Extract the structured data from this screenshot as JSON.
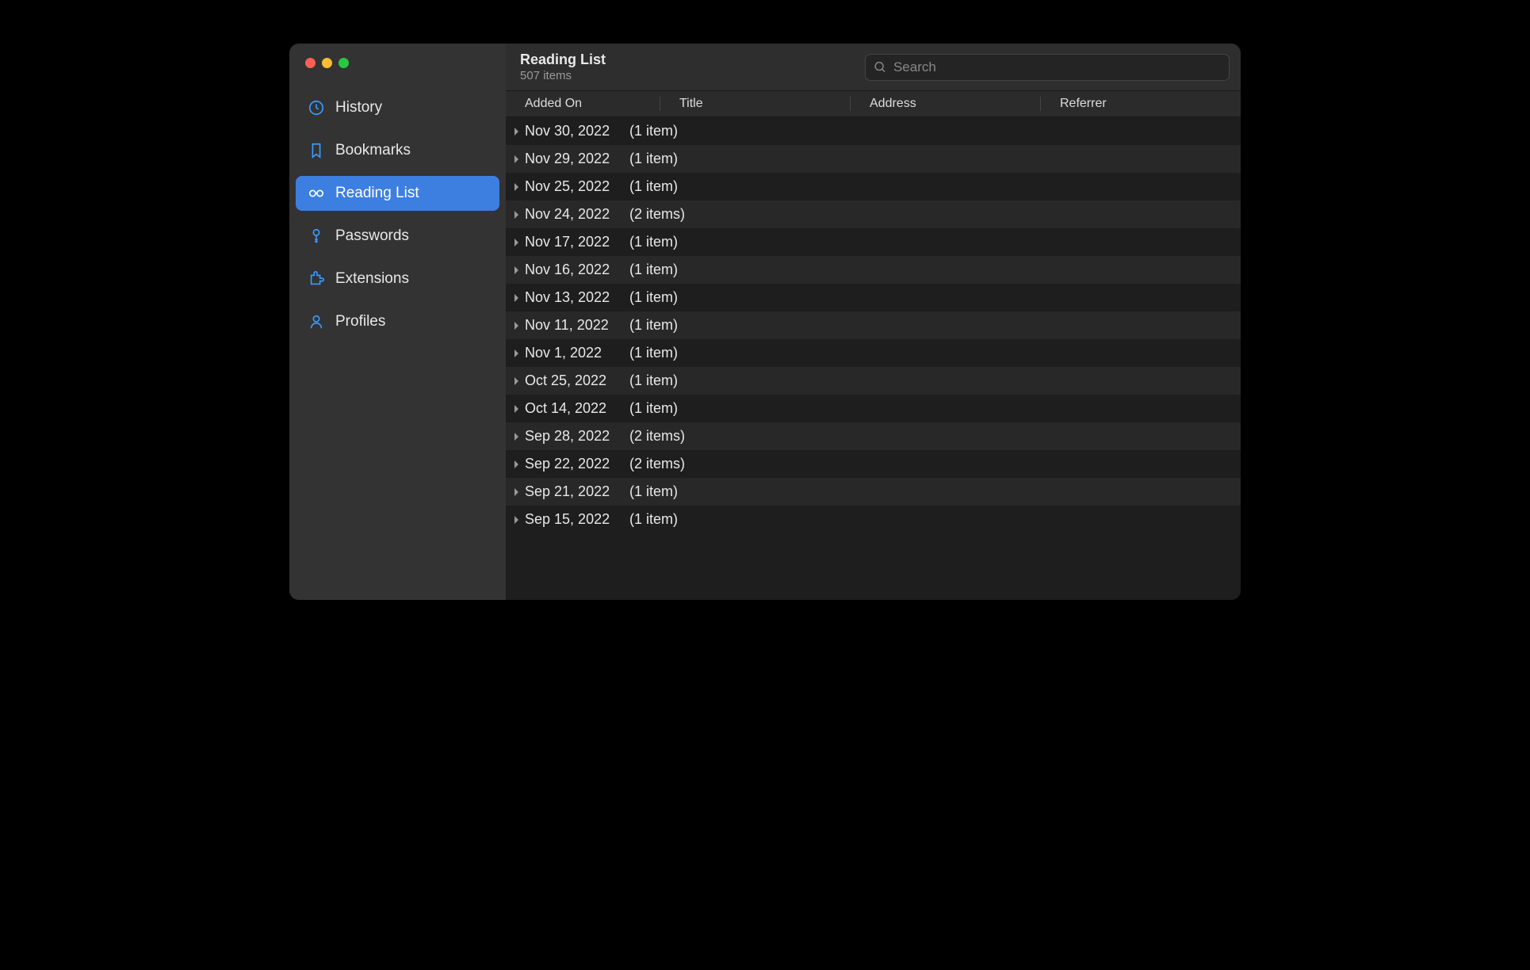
{
  "sidebar": {
    "items": [
      {
        "label": "History",
        "icon": "clock"
      },
      {
        "label": "Bookmarks",
        "icon": "bookmark"
      },
      {
        "label": "Reading List",
        "icon": "glasses"
      },
      {
        "label": "Passwords",
        "icon": "key"
      },
      {
        "label": "Extensions",
        "icon": "puzzle"
      },
      {
        "label": "Profiles",
        "icon": "person"
      }
    ],
    "active_index": 2
  },
  "header": {
    "title": "Reading List",
    "subtitle": "507 items"
  },
  "search": {
    "placeholder": "Search",
    "value": ""
  },
  "columns": {
    "added_on": "Added On",
    "title": "Title",
    "address": "Address",
    "referrer": "Referrer"
  },
  "rows": [
    {
      "date": "Nov 30, 2022",
      "count": "(1 item)"
    },
    {
      "date": "Nov 29, 2022",
      "count": "(1 item)"
    },
    {
      "date": "Nov 25, 2022",
      "count": "(1 item)"
    },
    {
      "date": "Nov 24, 2022",
      "count": "(2 items)"
    },
    {
      "date": "Nov 17, 2022",
      "count": "(1 item)"
    },
    {
      "date": "Nov 16, 2022",
      "count": "(1 item)"
    },
    {
      "date": "Nov 13, 2022",
      "count": "(1 item)"
    },
    {
      "date": "Nov 11, 2022",
      "count": "(1 item)"
    },
    {
      "date": "Nov 1, 2022",
      "count": "(1 item)"
    },
    {
      "date": "Oct 25, 2022",
      "count": "(1 item)"
    },
    {
      "date": "Oct 14, 2022",
      "count": "(1 item)"
    },
    {
      "date": "Sep 28, 2022",
      "count": "(2 items)"
    },
    {
      "date": "Sep 22, 2022",
      "count": "(2 items)"
    },
    {
      "date": "Sep 21, 2022",
      "count": "(1 item)"
    },
    {
      "date": "Sep 15, 2022",
      "count": "(1 item)"
    }
  ]
}
